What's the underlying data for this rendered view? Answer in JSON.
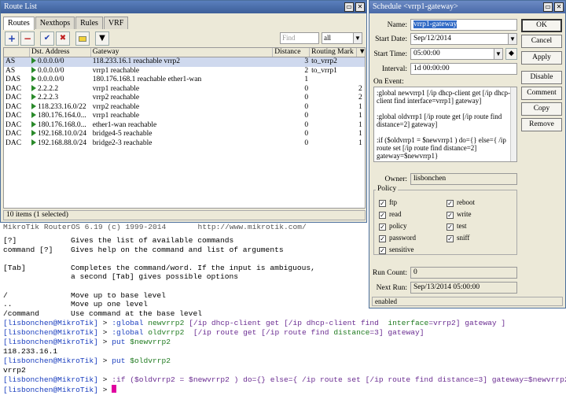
{
  "terminal": {
    "partial_header": "MikroTik RouterOS 6.19 (c) 1999-2014       http://www.mikrotik.com/",
    "help": [
      {
        "key": "[?]",
        "desc": "Gives the list of available commands"
      },
      {
        "key": "command [?]",
        "desc": "Gives help on the command and list of arguments"
      },
      {
        "key": "",
        "desc": ""
      },
      {
        "key": "[Tab]",
        "desc": "Completes the command/word. If the input is ambiguous,"
      },
      {
        "key": "",
        "desc": "a second [Tab] gives possible options"
      },
      {
        "key": "",
        "desc": ""
      },
      {
        "key": "/",
        "desc": "Move up to base level"
      },
      {
        "key": "..",
        "desc": "Move up one level"
      },
      {
        "key": "/command",
        "desc": "Use command at the base level"
      }
    ],
    "prompt_user": "[lisbonchen@MikroTik]",
    "prompt_sep": " > ",
    "cmd1": {
      "kw": ":global",
      "var": "newvrrp2",
      "rest1": " [/ip dhcp-client get [/ip dhcp-client find  ",
      "arg": "interface",
      "eq": "=vrrp2] gateway ]"
    },
    "cmd2": {
      "kw": ":global",
      "var": "oldvrrp2",
      "rest1": "  [/ip route get [/ip route find ",
      "arg": "distance",
      "eq": "=3] gateway]"
    },
    "cmd3": {
      "kw": "put",
      "var": "$newvrrp2"
    },
    "out3": "118.233.16.1",
    "cmd4": {
      "kw": "put",
      "var": "$oldvrrp2"
    },
    "out4": "vrrp2",
    "cmd5": ":if ($oldvrrp2 = $newvrrp2 ) do={} else={ /ip route set [/ip route find distance=3] gateway=$newvrrp2}"
  },
  "route_list": {
    "title": "Route List",
    "tabs": [
      "Routes",
      "Nexthops",
      "Rules",
      "VRF"
    ],
    "find_placeholder": "Find",
    "filter_value": "all",
    "columns": [
      "",
      "Dst. Address",
      "Gateway",
      "Distance",
      "Routing Mark"
    ],
    "rows": [
      {
        "type": "AS",
        "dst": "0.0.0.0/0",
        "gw": "118.233.16.1 reachable vrrp2",
        "dist": "3",
        "mark": "to_vrrp2",
        "x": "",
        "sel": true
      },
      {
        "type": "AS",
        "dst": "0.0.0.0/0",
        "gw": "vrrp1 reachable",
        "dist": "2",
        "mark": "to_vrrp1",
        "x": "",
        "sel": false
      },
      {
        "type": "DAS",
        "dst": "0.0.0.0/0",
        "gw": "180.176.168.1 reachable ether1-wan",
        "dist": "1",
        "mark": "",
        "x": "",
        "sel": false
      },
      {
        "type": "DAC",
        "dst": "2.2.2.2",
        "gw": "vrrp1 reachable",
        "dist": "0",
        "mark": "",
        "x": "2",
        "sel": false
      },
      {
        "type": "DAC",
        "dst": "2.2.2.3",
        "gw": "vrrp2 reachable",
        "dist": "0",
        "mark": "",
        "x": "2",
        "sel": false
      },
      {
        "type": "DAC",
        "dst": "118.233.16.0/22",
        "gw": "vrrp2 reachable",
        "dist": "0",
        "mark": "",
        "x": "1",
        "sel": false
      },
      {
        "type": "DAC",
        "dst": "180.176.164.0...",
        "gw": "vrrp1 reachable",
        "dist": "0",
        "mark": "",
        "x": "1",
        "sel": false
      },
      {
        "type": "DAC",
        "dst": "180.176.168.0...",
        "gw": "ether1-wan reachable",
        "dist": "0",
        "mark": "",
        "x": "1",
        "sel": false
      },
      {
        "type": "DAC",
        "dst": "192.168.10.0/24",
        "gw": "bridge4-5 reachable",
        "dist": "0",
        "mark": "",
        "x": "1",
        "sel": false
      },
      {
        "type": "DAC",
        "dst": "192.168.88.0/24",
        "gw": "bridge2-3 reachable",
        "dist": "0",
        "mark": "",
        "x": "1",
        "sel": false
      }
    ],
    "status": "10 items (1 selected)"
  },
  "schedule": {
    "title": "Schedule <vrrp1-gateway>",
    "name_label": "Name:",
    "name_value": "vrrp1-gateway",
    "start_date_label": "Start Date:",
    "start_date_value": "Sep/12/2014",
    "start_time_label": "Start Time:",
    "start_time_value": "05:00:00",
    "interval_label": "Interval:",
    "interval_value": "1d 00:00:00",
    "on_event_label": "On Event:",
    "on_event_lines": [
      ":global newvrrp1 [/ip dhcp-client get [/ip dhcp-client find interface=vrrp1] gateway]",
      "",
      ":global oldvrrp1 [/ip route get [/ip route find distance=2] gateway]",
      "",
      ":if ($oldvrrp1 = $newvrrp1 ) do={} else={ /ip route set [/ip route find distance=2] gateway=$newvrrp1}"
    ],
    "owner_label": "Owner:",
    "owner_value": "lisbonchen",
    "policy_label": "Policy",
    "policy_left": [
      "ftp",
      "read",
      "policy",
      "password",
      "sensitive"
    ],
    "policy_right": [
      "reboot",
      "write",
      "test",
      "sniff"
    ],
    "run_count_label": "Run Count:",
    "run_count_value": "0",
    "next_run_label": "Next Run:",
    "next_run_value": "Sep/13/2014 05:00:00",
    "status": "enabled",
    "buttons": {
      "ok": "OK",
      "cancel": "Cancel",
      "apply": "Apply",
      "disable": "Disable",
      "comment": "Comment",
      "copy": "Copy",
      "remove": "Remove"
    }
  },
  "colors": {
    "titlebar": "#3d5f99",
    "selection": "#316ac5",
    "prompt_user": "#1b3fbf",
    "cursor": "#e000a0"
  }
}
